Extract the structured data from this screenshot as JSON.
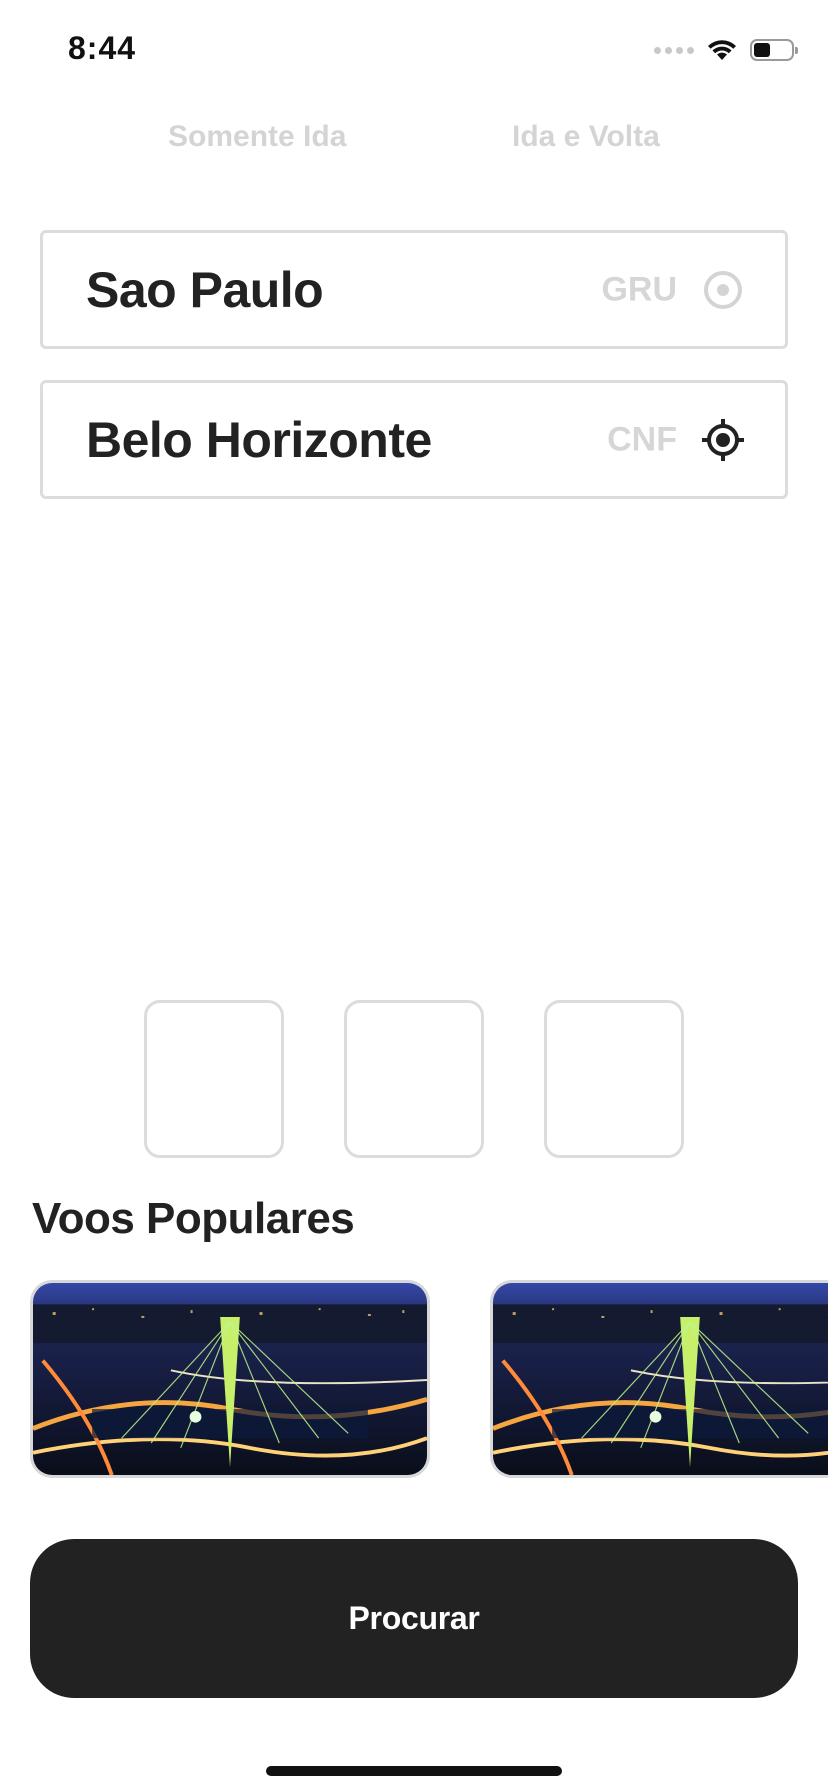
{
  "status_bar": {
    "time": "8:44",
    "battery_level": 0.45
  },
  "trip_type": {
    "one_way_label": "Somente Ida",
    "round_trip_label": "Ida e Volta"
  },
  "origin": {
    "city": "Sao Paulo",
    "code": "GRU",
    "icon": "radio-dot-icon"
  },
  "destination": {
    "city": "Belo Horizonte",
    "code": "CNF",
    "icon": "crosshair-icon"
  },
  "popular": {
    "title": "Voos Populares"
  },
  "search_button": {
    "label": "Procurar"
  },
  "colors": {
    "text_primary": "#222222",
    "muted": "#d4d4d4",
    "button_bg": "#222222",
    "button_text": "#ffffff"
  }
}
